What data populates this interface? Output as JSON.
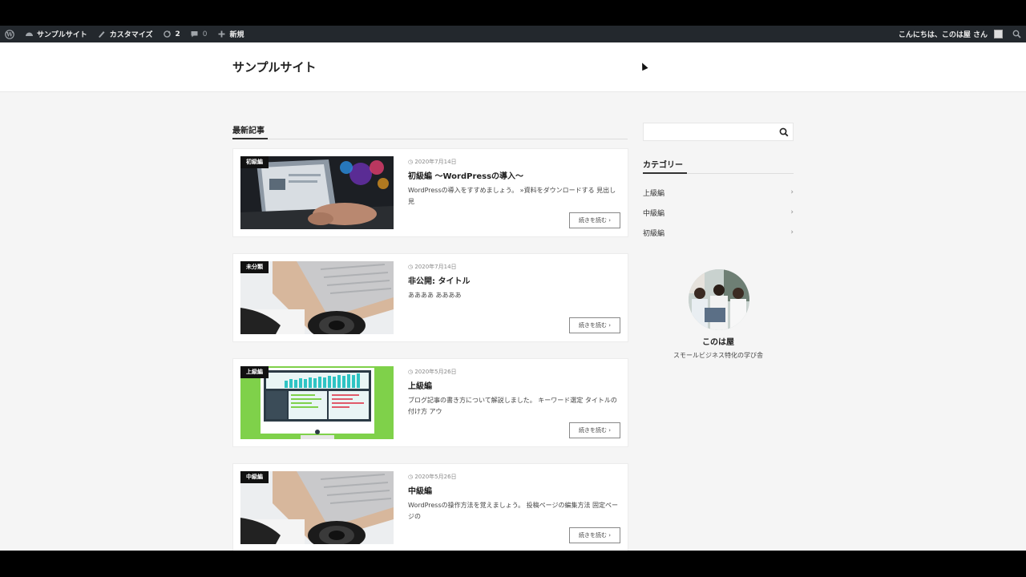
{
  "admin_bar": {
    "site_name": "サンプルサイト",
    "customize": "カスタマイズ",
    "updates_count": "2",
    "comments_count": "0",
    "new_label": "新規",
    "greeting": "こんにちは、このは屋 さん"
  },
  "header": {
    "site_title": "サンプルサイト"
  },
  "main": {
    "section_title": "最新記事",
    "read_more": "続きを読む",
    "posts": [
      {
        "category": "初級編",
        "date": "2020年7月14日",
        "title": "初級編 〜WordPressの導入〜",
        "excerpt": "WordPressの導入をすすめましょう。 »資料をダウンロードする 見出し 見"
      },
      {
        "category": "未分類",
        "date": "2020年7月14日",
        "title": "非公開: タイトル",
        "excerpt": "ああああ ああああ"
      },
      {
        "category": "上級編",
        "date": "2020年5月26日",
        "title": "上級編",
        "excerpt": "ブログ記事の書き方について解説しました。 キーワード選定 タイトルの付け方 アウ"
      },
      {
        "category": "中級編",
        "date": "2020年5月26日",
        "title": "中級編",
        "excerpt": "WordPressの操作方法を覚えましょう。 投稿ページの編集方法 固定ページの"
      }
    ]
  },
  "sidebar": {
    "categories_title": "カテゴリー",
    "categories": [
      "上級編",
      "中級編",
      "初級編"
    ],
    "profile_name": "このは屋",
    "profile_desc": "スモールビジネス特化の学び舎"
  },
  "colors": {
    "admin_bar_bg": "#23282d",
    "page_bg": "#f5f5f5",
    "label_bg": "#111111",
    "accent_green": "#7fd14a",
    "chart_teal": "#2ec4c4"
  }
}
